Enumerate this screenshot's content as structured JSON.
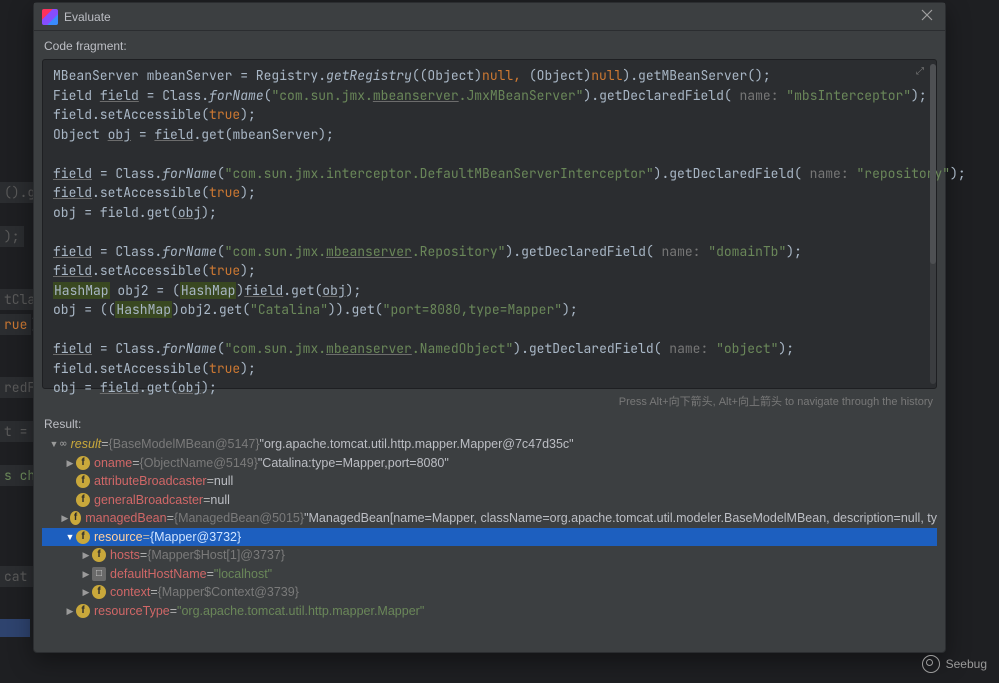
{
  "dialog": {
    "title": "Evaluate",
    "codeFragmentLabel": "Code fragment:",
    "hint": "Press Alt+向下箭头, Alt+向上箭头 to navigate through the history",
    "resultLabel": "Result:"
  },
  "code": {
    "line1a": "MBeanServer mbeanServer = Registry.",
    "line1b": "getRegistry",
    "line1c": "((Object)",
    "line1d": "null",
    "line1e": ",",
    "line1f": " (Object)",
    "line1g": "null",
    "line1h": ").getMBeanServer();",
    "line2a": "Field ",
    "line2b": "field",
    "line2c": " = Class.",
    "line2d": "forName",
    "line2e": "(",
    "line2f": "\"com.sun.jmx.",
    "line2g": "mbeanserver",
    "line2h": ".JmxMBeanServer\"",
    "line2i": ").getDeclaredField(",
    "line2j": " name: ",
    "line2k": "\"mbsInterceptor\"",
    "line2l": ");",
    "line3a": "field.setAccessible(",
    "line3b": "true",
    "line3c": ");",
    "line4a": "Object ",
    "line4b": "obj",
    "line4c": " = ",
    "line4d": "field",
    "line4e": ".get(mbeanServer);",
    "line6a": "field",
    "line6b": " = Class.",
    "line6c": "forName",
    "line6d": "(",
    "line6e": "\"com.sun.jmx.interceptor.DefaultMBeanServerInterceptor\"",
    "line6f": ").getDeclaredField(",
    "line6g": " name: ",
    "line6h": "\"repository\"",
    "line6i": ");",
    "line7a": "field",
    "line7b": ".setAccessible(",
    "line7c": "true",
    "line7d": ");",
    "line8a": "obj = field.get(",
    "line8b": "obj",
    "line8c": ");",
    "line10a": "field",
    "line10b": " = Class.",
    "line10c": "forName",
    "line10d": "(",
    "line10e": "\"com.sun.jmx.",
    "line10f": "mbeanserver",
    "line10g": ".Repository\"",
    "line10h": ").getDeclaredField(",
    "line10i": " name: ",
    "line10j": "\"domainTb\"",
    "line10k": ");",
    "line11a": "field",
    "line11b": ".setAccessible(",
    "line11c": "true",
    "line11d": ");",
    "line12a": "HashMap",
    "line12b": " obj2 = (",
    "line12c": "HashMap",
    "line12d": ")",
    "line12e": "field",
    "line12f": ".get(",
    "line12g": "obj",
    "line12h": ");",
    "line13a": "obj = ((",
    "line13b": "HashMap",
    "line13c": ")obj2.get(",
    "line13d": "\"Catalina\"",
    "line13e": ")).get(",
    "line13f": "\"port=8080,type=Mapper\"",
    "line13g": ");",
    "line15a": "field",
    "line15b": " = Class.",
    "line15c": "forName",
    "line15d": "(",
    "line15e": "\"com.sun.jmx.",
    "line15f": "mbeanserver",
    "line15g": ".NamedObject\"",
    "line15h": ").getDeclaredField(",
    "line15i": " name: ",
    "line15j": "\"object\"",
    "line15k": ");",
    "line16a": "field.setAccessible(",
    "line16b": "true",
    "line16c": ");",
    "line17a": "obj = ",
    "line17b": "field",
    "line17c": ".get(",
    "line17d": "obj",
    "line17e": ");"
  },
  "tree": {
    "r0": {
      "name": "result",
      "eq": " = ",
      "type": "{BaseModelMBean@5147}",
      "val": " \"org.apache.tomcat.util.http.mapper.Mapper@7c47d35c\""
    },
    "r1": {
      "name": "oname",
      "eq": " = ",
      "type": "{ObjectName@5149}",
      "val": " \"Catalina:type=Mapper,port=8080\""
    },
    "r2": {
      "name": "attributeBroadcaster",
      "eq": " = ",
      "val": "null"
    },
    "r3": {
      "name": "generalBroadcaster",
      "eq": " = ",
      "val": "null"
    },
    "r4": {
      "name": "managedBean",
      "eq": " = ",
      "type": "{ManagedBean@5015}",
      "val": " \"ManagedBean[name=Mapper, className=org.apache.tomcat.util.modeler.BaseModelMBean, description=null, ty"
    },
    "r5": {
      "name": "resource",
      "eq": " = ",
      "type": "{Mapper@3732}"
    },
    "r6": {
      "name": "hosts",
      "eq": " = ",
      "type": "{Mapper$Host[1]@3737}"
    },
    "r7": {
      "name": "defaultHostName",
      "eq": " = ",
      "val": "\"localhost\""
    },
    "r8": {
      "name": "context",
      "eq": " = ",
      "type": "{Mapper$Context@3739}"
    },
    "r9": {
      "name": "resourceType",
      "eq": " = ",
      "val": "\"org.apache.tomcat.util.http.mapper.Mapper\""
    }
  },
  "watermark": "Seebug"
}
